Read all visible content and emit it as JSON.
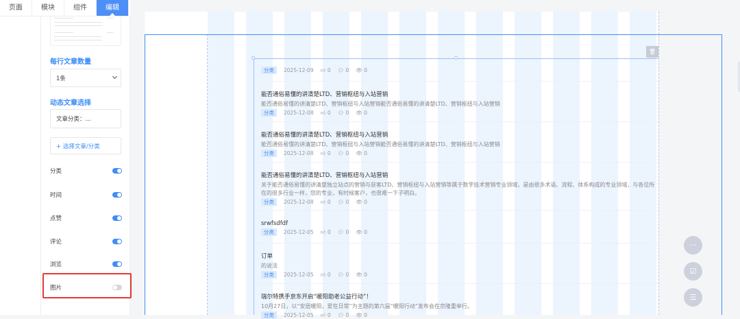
{
  "tabs": [
    "页面",
    "模块",
    "组件",
    "编辑"
  ],
  "settings": {
    "per_row_label": "每行文章数量",
    "per_row_value": "1条",
    "dynamic_label": "动态文章选择",
    "category_value": "文章分类：...",
    "select_button": "+ 选择文章/分类",
    "toggles": [
      {
        "label": "分类",
        "on": true
      },
      {
        "label": "时间",
        "on": true
      },
      {
        "label": "点赞",
        "on": true
      },
      {
        "label": "评论",
        "on": true
      },
      {
        "label": "浏览",
        "on": true
      },
      {
        "label": "图片",
        "on": false
      }
    ]
  },
  "articles": [
    {
      "title": "",
      "desc": "",
      "tag": "分类",
      "date": "2025-12-09",
      "likes": "0",
      "comments": "0",
      "views": "0"
    },
    {
      "title": "能否通俗易懂的讲清楚LTD、营销枢纽与入站营销",
      "desc": "能否通俗易懂的讲清楚LTD、营销枢纽与入站营销能否通俗易懂的讲清楚LTD、营销枢纽与入站营销",
      "tag": "分类",
      "date": "2025-12-08",
      "likes": "0",
      "comments": "0",
      "views": "0"
    },
    {
      "title": "能否通俗易懂的讲清楚LTD、营销枢纽与入站营销",
      "desc": "能否通俗易懂的讲清楚LTD、营销枢纽与入站营销能否通俗易懂的讲清楚LTD、营销枢纽与入站营销",
      "tag": "分类",
      "date": "2025-12-08",
      "likes": "0",
      "comments": "0",
      "views": "0"
    },
    {
      "title": "能否通俗易懂的讲清楚LTD、营销枢纽与入站营销",
      "desc": "关于能否通俗易懂的讲清楚独立站点的营销与获客LTD、营销枢纽与入站营销等属于数字技术营销专业领域，是由很多术语、流程、体系构成的专业领域，与各位所在的很多行业一样，您的专业，有时候客户，也很难一下子明白。",
      "tag": "分类",
      "date": "2025-12-08",
      "likes": "0",
      "comments": "0",
      "views": "0"
    },
    {
      "title": "srwfsdfdf",
      "desc": "",
      "tag": "分类",
      "date": "2025-12-05",
      "likes": "0",
      "comments": "0",
      "views": "0"
    },
    {
      "title": "订单",
      "desc": "的说法",
      "tag": "分类",
      "date": "2025-12-05",
      "likes": "0",
      "comments": "0",
      "views": "0"
    },
    {
      "title": "瑞尔特携手京东开启“暖阳助老公益行动”！",
      "desc": "10月27日，以“安居暖阳，爱在日常”为主题的第六届“暖阳行动”发布会在京隆重举行。",
      "tag": "分类",
      "date": "2025-12-05",
      "likes": "0",
      "comments": "0",
      "views": "0"
    }
  ]
}
